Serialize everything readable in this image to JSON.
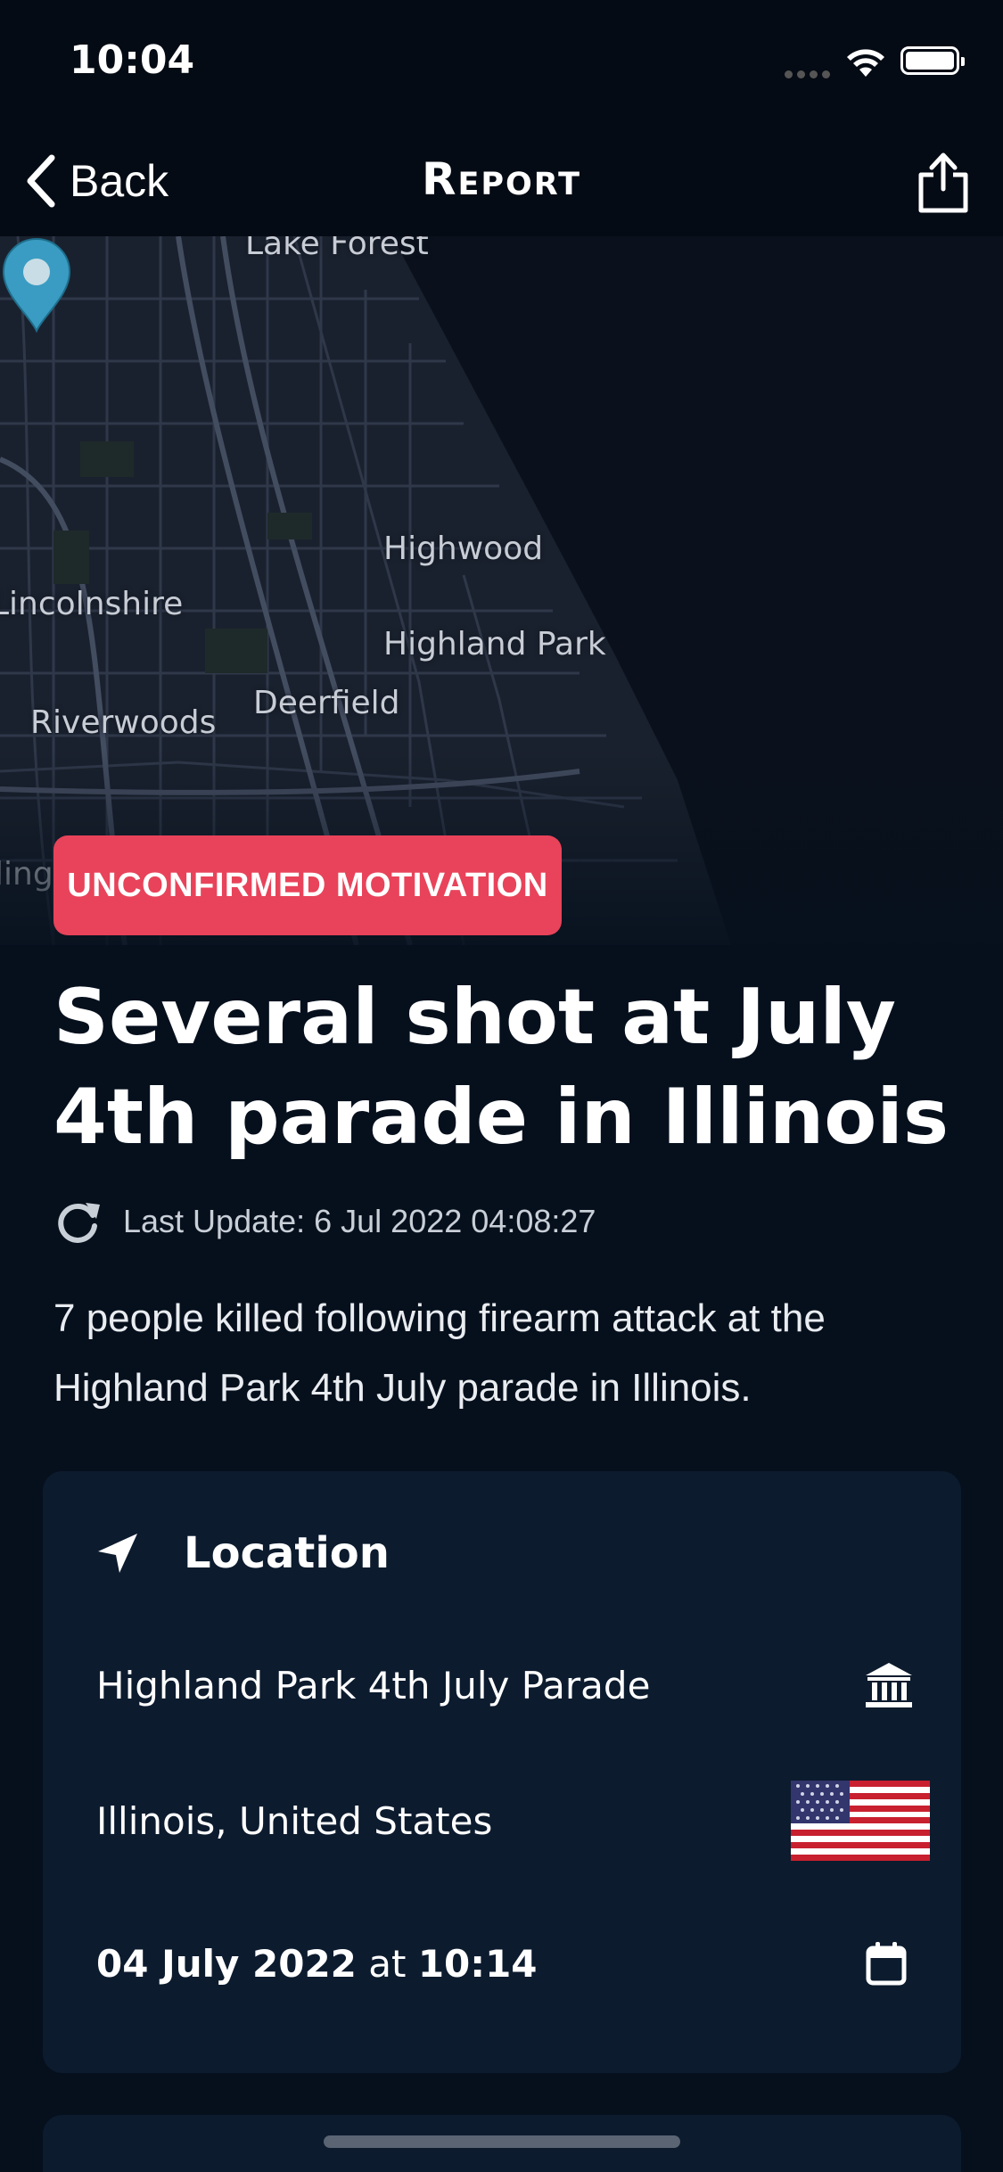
{
  "status_bar": {
    "time": "10:04"
  },
  "nav": {
    "back_label": "Back",
    "title": "Report"
  },
  "map": {
    "labels": {
      "lake_forest": "Lake Forest",
      "highwood": "Highwood",
      "lincolnshire": "Lincolnshire",
      "highland_park": "Highland Park",
      "riverwoods": "Riverwoods",
      "deerfield": "Deerfield",
      "edge": "ling"
    },
    "pin_color": "#3a9cc2"
  },
  "badge": {
    "label": "UNCONFIRMED MOTIVATION",
    "color": "#e8435a"
  },
  "report": {
    "headline": "Several shot at July 4th parade in Illinois",
    "last_update": "Last Update: 6 Jul 2022 04:08:27",
    "summary": "7 people killed following firearm attack at the Highland Park 4th July parade in Illinois."
  },
  "location_card": {
    "title": "Location",
    "place": "Highland Park 4th July Parade",
    "region": "Illinois, United States",
    "date": "04 July 2022",
    "at": "at",
    "time": "10:14"
  },
  "icons": [
    "back-chevron-icon",
    "share-icon",
    "map-pin-icon",
    "refresh-icon",
    "location-arrow-icon",
    "landmark-icon",
    "us-flag-icon",
    "calendar-icon"
  ]
}
